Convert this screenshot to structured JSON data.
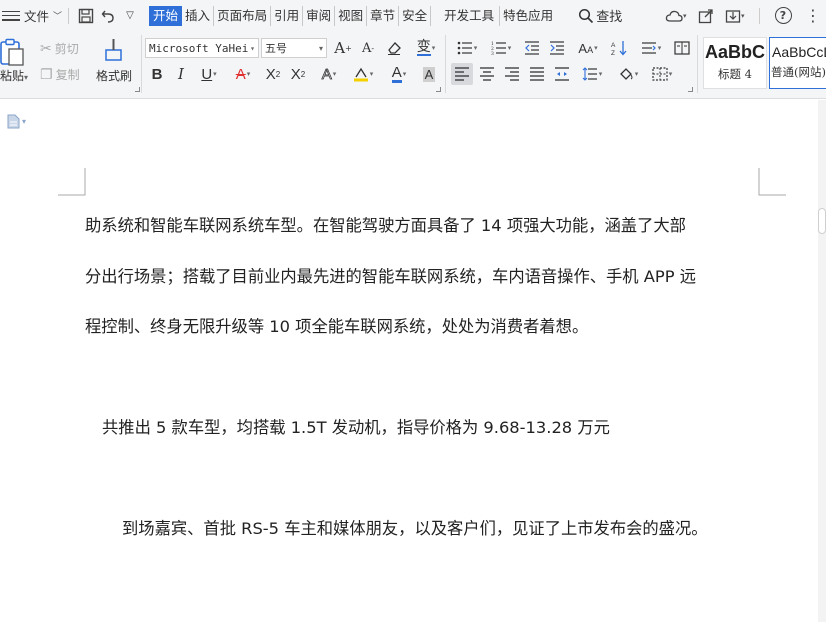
{
  "menubar": {
    "file_label": "文件",
    "tabs": [
      "开始",
      "插入",
      "页面布局",
      "引用",
      "审阅",
      "视图",
      "章节",
      "安全",
      "开发工具",
      "特色应用"
    ],
    "search_label": "查找"
  },
  "ribbon": {
    "paste_label": "粘贴",
    "cut_label": "剪切",
    "copy_label": "复制",
    "format_painter_label": "格式刷",
    "font_name": "Microsoft YaHei",
    "font_size": "五号",
    "styles": [
      {
        "preview": "AaBbC",
        "label": "标题 4"
      },
      {
        "preview": "AaBbCcD",
        "label": "普通(网站)"
      }
    ]
  },
  "document": {
    "paragraphs": [
      "助系统和智能车联网系统车型。在智能驾驶方面具备了 14 项强大功能，涵盖了大部",
      "分出行场景；搭载了目前业内最先进的智能车联网系统，车内语音操作、手机 APP 远",
      "程控制、终身无限升级等 10 项全能车联网系统，处处为消费者着想。",
      "共推出 5 款车型，均搭载 1.5T 发动机，指导价格为 9.68-13.28 万元",
      "到场嘉宾、首批 RS-5 车主和媒体朋友，以及客户们，见证了上市发布会的盛况。"
    ]
  },
  "colors": {
    "accent": "#2e6fd8",
    "font_color_underline": "#e03030",
    "highlight_underline": "#f5d000",
    "text_color_underline": "#2e6fd8"
  }
}
